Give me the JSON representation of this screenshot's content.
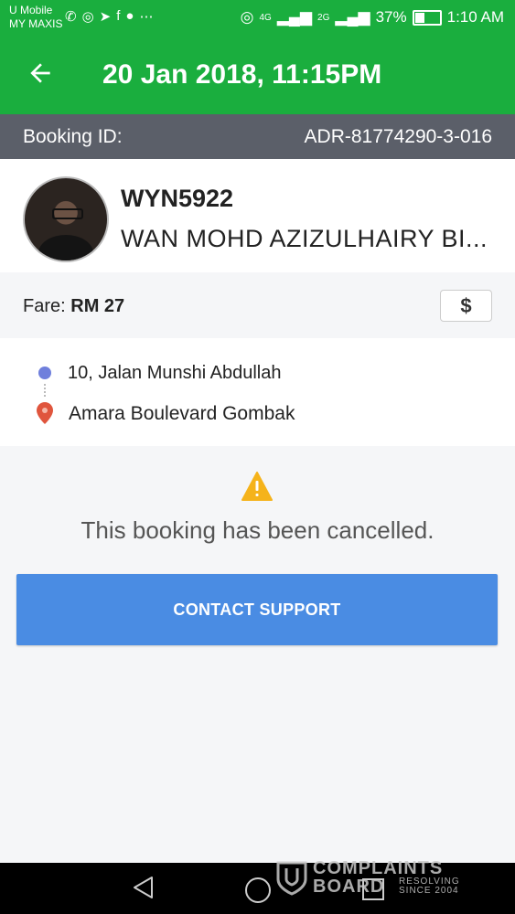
{
  "status_bar": {
    "carrier_line1": "U Mobile",
    "carrier_line2": "MY MAXIS",
    "network1": "4G",
    "network2": "2G",
    "battery": "37%",
    "time": "1:10 AM",
    "battery_level": 0.37
  },
  "header": {
    "title": "20 Jan 2018, 11:15PM"
  },
  "booking": {
    "label": "Booking ID:",
    "id": "ADR-81774290-3-016"
  },
  "driver": {
    "plate": "WYN5922",
    "name": "WAN MOHD AZIZULHAIRY BI..."
  },
  "fare": {
    "label": "Fare:",
    "amount": "RM 27",
    "payment_icon": "$"
  },
  "route": {
    "pickup": "10, Jalan Munshi Abdullah",
    "dropoff": "Amara Boulevard Gombak"
  },
  "status": {
    "message": "This booking has been cancelled."
  },
  "actions": {
    "contact_support": "CONTACT SUPPORT"
  },
  "watermark": {
    "line1": "COMPLAINTS",
    "line2": "BOARD",
    "line3": "RESOLVING",
    "line4": "SINCE 2004"
  },
  "colors": {
    "brand_green": "#1aae3e",
    "booking_bar": "#5b5f69",
    "button_blue": "#4a8ce3",
    "pickup_dot": "#6f7fdc",
    "dropoff_pin": "#e0553d",
    "warning": "#f5b31b"
  }
}
